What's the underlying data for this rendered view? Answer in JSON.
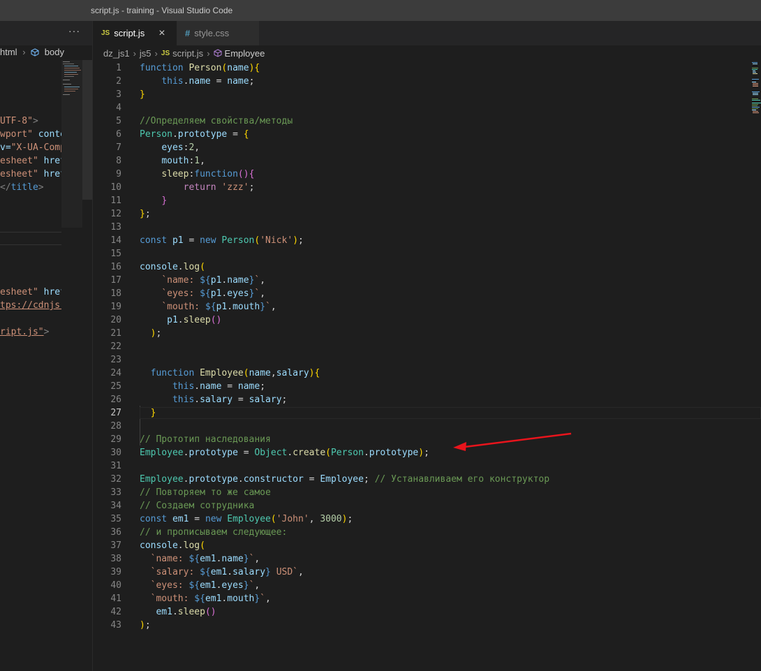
{
  "window": {
    "title": "script.js - training - Visual Studio Code"
  },
  "left_pane": {
    "more_label": "···",
    "breadcrumb": {
      "item1": "html",
      "item2": "body"
    },
    "code_lines": [
      {
        "parts": [
          {
            "t": "UTF-8\"",
            "c": "str"
          },
          {
            "t": ">",
            "c": "tag"
          }
        ]
      },
      {
        "parts": [
          {
            "t": "wport\"",
            "c": "str"
          },
          {
            "t": " conte",
            "c": "attr"
          }
        ]
      },
      {
        "parts": [
          {
            "t": "v=",
            "c": "attr"
          },
          {
            "t": "\"X-UA-Comp",
            "c": "str"
          }
        ]
      },
      {
        "parts": [
          {
            "t": "esheet\"",
            "c": "str"
          },
          {
            "t": " href",
            "c": "attr"
          }
        ]
      },
      {
        "parts": [
          {
            "t": "esheet\"",
            "c": "str"
          },
          {
            "t": " href",
            "c": "attr"
          }
        ]
      },
      {
        "parts": [
          {
            "t": "</",
            "c": "tag"
          },
          {
            "t": "title",
            "c": "tagname"
          },
          {
            "t": ">",
            "c": "tag"
          }
        ]
      },
      {
        "parts": [
          {
            "t": "esheet\"",
            "c": "str"
          },
          {
            "t": " href",
            "c": "attr"
          }
        ]
      },
      {
        "parts": [
          {
            "t": "tps://cdnjs.",
            "c": "strul"
          }
        ]
      },
      {
        "parts": [
          {
            "t": "ript.js\"",
            "c": "strul"
          },
          {
            "t": ">",
            "c": "tag"
          }
        ]
      }
    ]
  },
  "tabs": [
    {
      "icon": "JS",
      "label": "script.js",
      "close": "×",
      "active": true
    },
    {
      "icon": "#",
      "label": "style.css",
      "active": false
    }
  ],
  "breadcrumb": {
    "folder1": "dz_js1",
    "folder2": "js5",
    "file_icon": "JS",
    "file": "script.js",
    "symbol": "Employee"
  },
  "editor": {
    "active_line": 27,
    "lines": [
      {
        "n": "1",
        "parts": [
          {
            "t": "function ",
            "c": "kw"
          },
          {
            "t": "Person",
            "c": "fn"
          },
          {
            "t": "(",
            "c": "br1"
          },
          {
            "t": "name",
            "c": "var"
          },
          {
            "t": ")",
            "c": "br1"
          },
          {
            "t": "{",
            "c": "br1"
          }
        ]
      },
      {
        "n": "2",
        "parts": [
          {
            "t": "    "
          },
          {
            "t": "this",
            "c": "kw"
          },
          {
            "t": "."
          },
          {
            "t": "name",
            "c": "var"
          },
          {
            "t": " = "
          },
          {
            "t": "name",
            "c": "var"
          },
          {
            "t": ";"
          }
        ]
      },
      {
        "n": "3",
        "parts": [
          {
            "t": "}",
            "c": "br1"
          }
        ]
      },
      {
        "n": "4",
        "parts": []
      },
      {
        "n": "5",
        "parts": [
          {
            "t": "//Определяем свойства/методы",
            "c": "cmt"
          }
        ]
      },
      {
        "n": "6",
        "parts": [
          {
            "t": "Person",
            "c": "cls"
          },
          {
            "t": "."
          },
          {
            "t": "prototype",
            "c": "var"
          },
          {
            "t": " = "
          },
          {
            "t": "{",
            "c": "br1"
          }
        ]
      },
      {
        "n": "7",
        "parts": [
          {
            "t": "    "
          },
          {
            "t": "eyes",
            "c": "var"
          },
          {
            "t": ":"
          },
          {
            "t": "2",
            "c": "num"
          },
          {
            "t": ","
          }
        ]
      },
      {
        "n": "8",
        "parts": [
          {
            "t": "    "
          },
          {
            "t": "mouth",
            "c": "var"
          },
          {
            "t": ":"
          },
          {
            "t": "1",
            "c": "num"
          },
          {
            "t": ","
          }
        ]
      },
      {
        "n": "9",
        "parts": [
          {
            "t": "    "
          },
          {
            "t": "sleep",
            "c": "fn"
          },
          {
            "t": ":"
          },
          {
            "t": "function",
            "c": "kw"
          },
          {
            "t": "(",
            "c": "br2"
          },
          {
            "t": ")",
            "c": "br2"
          },
          {
            "t": "{",
            "c": "br2"
          }
        ]
      },
      {
        "n": "10",
        "parts": [
          {
            "t": "        "
          },
          {
            "t": "return ",
            "c": "kw2"
          },
          {
            "t": "'zzz'",
            "c": "str"
          },
          {
            "t": ";"
          }
        ]
      },
      {
        "n": "11",
        "parts": [
          {
            "t": "    "
          },
          {
            "t": "}",
            "c": "br2"
          }
        ]
      },
      {
        "n": "12",
        "parts": [
          {
            "t": "}",
            "c": "br1"
          },
          {
            "t": ";"
          }
        ]
      },
      {
        "n": "13",
        "parts": []
      },
      {
        "n": "14",
        "parts": [
          {
            "t": "const ",
            "c": "kw"
          },
          {
            "t": "p1",
            "c": "var"
          },
          {
            "t": " = "
          },
          {
            "t": "new ",
            "c": "kw"
          },
          {
            "t": "Person",
            "c": "cls"
          },
          {
            "t": "(",
            "c": "br1"
          },
          {
            "t": "'Nick'",
            "c": "str"
          },
          {
            "t": ")",
            "c": "br1"
          },
          {
            "t": ";"
          }
        ]
      },
      {
        "n": "15",
        "parts": []
      },
      {
        "n": "16",
        "parts": [
          {
            "t": "console",
            "c": "var"
          },
          {
            "t": "."
          },
          {
            "t": "log",
            "c": "fn"
          },
          {
            "t": "(",
            "c": "br1"
          }
        ]
      },
      {
        "n": "17",
        "parts": [
          {
            "t": "    "
          },
          {
            "t": "`name: ",
            "c": "str"
          },
          {
            "t": "${",
            "c": "kw"
          },
          {
            "t": "p1",
            "c": "var"
          },
          {
            "t": "."
          },
          {
            "t": "name",
            "c": "var"
          },
          {
            "t": "}",
            "c": "kw"
          },
          {
            "t": "`",
            "c": "str"
          },
          {
            "t": ","
          }
        ]
      },
      {
        "n": "18",
        "parts": [
          {
            "t": "    "
          },
          {
            "t": "`eyes: ",
            "c": "str"
          },
          {
            "t": "${",
            "c": "kw"
          },
          {
            "t": "p1",
            "c": "var"
          },
          {
            "t": "."
          },
          {
            "t": "eyes",
            "c": "var"
          },
          {
            "t": "}",
            "c": "kw"
          },
          {
            "t": "`",
            "c": "str"
          },
          {
            "t": ","
          }
        ]
      },
      {
        "n": "19",
        "parts": [
          {
            "t": "    "
          },
          {
            "t": "`mouth: ",
            "c": "str"
          },
          {
            "t": "${",
            "c": "kw"
          },
          {
            "t": "p1",
            "c": "var"
          },
          {
            "t": "."
          },
          {
            "t": "mouth",
            "c": "var"
          },
          {
            "t": "}",
            "c": "kw"
          },
          {
            "t": "`",
            "c": "str"
          },
          {
            "t": ","
          }
        ]
      },
      {
        "n": "20",
        "parts": [
          {
            "t": "     "
          },
          {
            "t": "p1",
            "c": "var"
          },
          {
            "t": "."
          },
          {
            "t": "sleep",
            "c": "fn"
          },
          {
            "t": "(",
            "c": "br2"
          },
          {
            "t": ")",
            "c": "br2"
          }
        ]
      },
      {
        "n": "21",
        "parts": [
          {
            "t": "  "
          },
          {
            "t": ")",
            "c": "br1"
          },
          {
            "t": ";"
          }
        ]
      },
      {
        "n": "22",
        "parts": []
      },
      {
        "n": "23",
        "parts": []
      },
      {
        "n": "24",
        "parts": [
          {
            "t": "  "
          },
          {
            "t": "function ",
            "c": "kw"
          },
          {
            "t": "Employee",
            "c": "fn"
          },
          {
            "t": "(",
            "c": "br1"
          },
          {
            "t": "name",
            "c": "var"
          },
          {
            "t": ","
          },
          {
            "t": "salary",
            "c": "var"
          },
          {
            "t": ")",
            "c": "br1"
          },
          {
            "t": "{",
            "c": "br1"
          }
        ]
      },
      {
        "n": "25",
        "parts": [
          {
            "t": "      "
          },
          {
            "t": "this",
            "c": "kw"
          },
          {
            "t": "."
          },
          {
            "t": "name",
            "c": "var"
          },
          {
            "t": " = "
          },
          {
            "t": "name",
            "c": "var"
          },
          {
            "t": ";"
          }
        ]
      },
      {
        "n": "26",
        "parts": [
          {
            "t": "      "
          },
          {
            "t": "this",
            "c": "kw"
          },
          {
            "t": "."
          },
          {
            "t": "salary",
            "c": "var"
          },
          {
            "t": " = "
          },
          {
            "t": "salary",
            "c": "var"
          },
          {
            "t": ";"
          }
        ]
      },
      {
        "n": "27",
        "parts": [
          {
            "t": "  "
          },
          {
            "t": "}",
            "c": "br1"
          }
        ]
      },
      {
        "n": "28",
        "parts": []
      },
      {
        "n": "29",
        "parts": [
          {
            "t": "// Прототип наследования",
            "c": "cmt"
          }
        ]
      },
      {
        "n": "30",
        "parts": [
          {
            "t": "Employee",
            "c": "cls"
          },
          {
            "t": "."
          },
          {
            "t": "prototype",
            "c": "var"
          },
          {
            "t": " = "
          },
          {
            "t": "Object",
            "c": "cls"
          },
          {
            "t": "."
          },
          {
            "t": "create",
            "c": "fn"
          },
          {
            "t": "(",
            "c": "br1"
          },
          {
            "t": "Person",
            "c": "cls"
          },
          {
            "t": "."
          },
          {
            "t": "prototype",
            "c": "var"
          },
          {
            "t": ")",
            "c": "br1"
          },
          {
            "t": ";"
          }
        ]
      },
      {
        "n": "31",
        "parts": []
      },
      {
        "n": "32",
        "parts": [
          {
            "t": "Employee",
            "c": "cls"
          },
          {
            "t": "."
          },
          {
            "t": "prototype",
            "c": "var"
          },
          {
            "t": "."
          },
          {
            "t": "constructor",
            "c": "var"
          },
          {
            "t": " = "
          },
          {
            "t": "Employee",
            "c": "var"
          },
          {
            "t": "; "
          },
          {
            "t": "// Устанавливаем его конструктор",
            "c": "cmt"
          }
        ]
      },
      {
        "n": "33",
        "parts": [
          {
            "t": "// Повторяем то же самое",
            "c": "cmt"
          }
        ]
      },
      {
        "n": "34",
        "parts": [
          {
            "t": "// Создаем сотрудника",
            "c": "cmt"
          }
        ]
      },
      {
        "n": "35",
        "parts": [
          {
            "t": "const ",
            "c": "kw"
          },
          {
            "t": "em1",
            "c": "var"
          },
          {
            "t": " = "
          },
          {
            "t": "new ",
            "c": "kw"
          },
          {
            "t": "Employee",
            "c": "cls"
          },
          {
            "t": "(",
            "c": "br1"
          },
          {
            "t": "'John'",
            "c": "str"
          },
          {
            "t": ", "
          },
          {
            "t": "3000",
            "c": "num"
          },
          {
            "t": ")",
            "c": "br1"
          },
          {
            "t": ";"
          }
        ]
      },
      {
        "n": "36",
        "parts": [
          {
            "t": "// и прописываем следующее:",
            "c": "cmt"
          }
        ]
      },
      {
        "n": "37",
        "parts": [
          {
            "t": "console",
            "c": "var"
          },
          {
            "t": "."
          },
          {
            "t": "log",
            "c": "fn"
          },
          {
            "t": "(",
            "c": "br1"
          }
        ]
      },
      {
        "n": "38",
        "parts": [
          {
            "t": "  "
          },
          {
            "t": "`name: ",
            "c": "str"
          },
          {
            "t": "${",
            "c": "kw"
          },
          {
            "t": "em1",
            "c": "var"
          },
          {
            "t": "."
          },
          {
            "t": "name",
            "c": "var"
          },
          {
            "t": "}",
            "c": "kw"
          },
          {
            "t": "`",
            "c": "str"
          },
          {
            "t": ","
          }
        ]
      },
      {
        "n": "39",
        "parts": [
          {
            "t": "  "
          },
          {
            "t": "`salary: ",
            "c": "str"
          },
          {
            "t": "${",
            "c": "kw"
          },
          {
            "t": "em1",
            "c": "var"
          },
          {
            "t": "."
          },
          {
            "t": "salary",
            "c": "var"
          },
          {
            "t": "}",
            "c": "kw"
          },
          {
            "t": " USD`",
            "c": "str"
          },
          {
            "t": ","
          }
        ]
      },
      {
        "n": "40",
        "parts": [
          {
            "t": "  "
          },
          {
            "t": "`eyes: ",
            "c": "str"
          },
          {
            "t": "${",
            "c": "kw"
          },
          {
            "t": "em1",
            "c": "var"
          },
          {
            "t": "."
          },
          {
            "t": "eyes",
            "c": "var"
          },
          {
            "t": "}",
            "c": "kw"
          },
          {
            "t": "`",
            "c": "str"
          },
          {
            "t": ","
          }
        ]
      },
      {
        "n": "41",
        "parts": [
          {
            "t": "  "
          },
          {
            "t": "`mouth: ",
            "c": "str"
          },
          {
            "t": "${",
            "c": "kw"
          },
          {
            "t": "em1",
            "c": "var"
          },
          {
            "t": "."
          },
          {
            "t": "mouth",
            "c": "var"
          },
          {
            "t": "}",
            "c": "kw"
          },
          {
            "t": "`",
            "c": "str"
          },
          {
            "t": ","
          }
        ]
      },
      {
        "n": "42",
        "parts": [
          {
            "t": "   "
          },
          {
            "t": "em1",
            "c": "var"
          },
          {
            "t": "."
          },
          {
            "t": "sleep",
            "c": "fn"
          },
          {
            "t": "(",
            "c": "br2"
          },
          {
            "t": ")",
            "c": "br2"
          }
        ]
      },
      {
        "n": "43",
        "parts": [
          {
            "t": ")",
            "c": "br1"
          },
          {
            "t": ";"
          }
        ]
      }
    ]
  },
  "colors": {
    "annotation_arrow": "#e8141c"
  }
}
